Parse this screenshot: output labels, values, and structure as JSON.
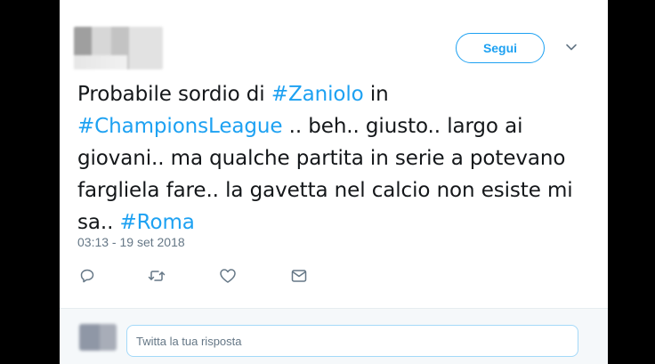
{
  "header": {
    "follow_label": "Segui"
  },
  "tweet": {
    "text_parts": [
      {
        "text": "Probabile sordio di ",
        "hashtag": false
      },
      {
        "text": "#Zaniolo",
        "hashtag": true
      },
      {
        "text": " in ",
        "hashtag": false
      },
      {
        "text": "#ChampionsLeague",
        "hashtag": true
      },
      {
        "text": " .. beh.. giusto.. largo ai giovani.. ma qualche partita in serie a potevano fargliela fare.. la gavetta nel calcio non esiste mi sa.. ",
        "hashtag": false
      },
      {
        "text": "#Roma",
        "hashtag": true
      }
    ],
    "timestamp": "03:13 - 19 set 2018"
  },
  "actions": {
    "icons": [
      "reply-icon",
      "retweet-icon",
      "like-icon",
      "message-icon"
    ]
  },
  "reply": {
    "placeholder": "Twitta la tua risposta"
  },
  "colors": {
    "accent": "#1da1f2",
    "text": "#14171a",
    "muted": "#657786"
  }
}
